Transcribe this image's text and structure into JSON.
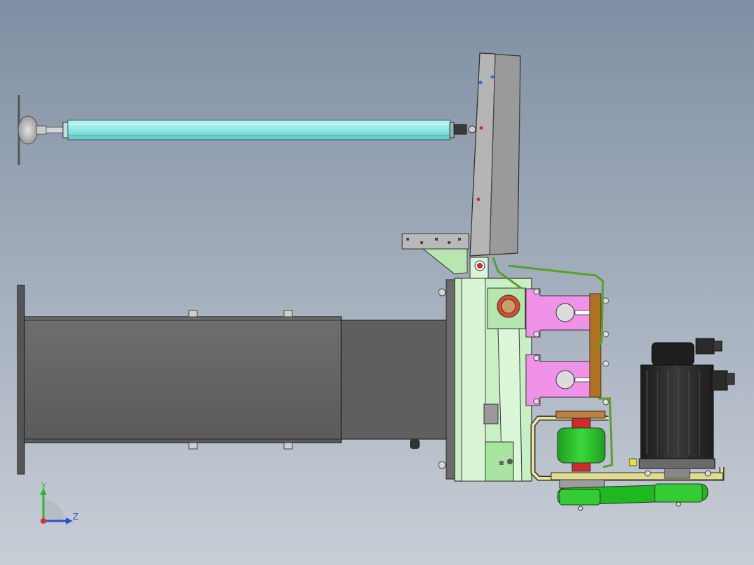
{
  "view": {
    "background_top": "#7f8fa3",
    "background_bottom": "#c8ced6"
  },
  "triad": {
    "y_label": "Y",
    "z_label": "Z",
    "y_color": "#2fb52f",
    "z_color": "#2f4fd6",
    "x_color": "#d62f2f"
  },
  "colors": {
    "rod_cyan": "#8fe8e6",
    "frame_gray": "#616161",
    "frame_dark": "#4e4e4e",
    "plate_gray": "#a9a9a9",
    "bracket_green": "#c9f0c4",
    "clamp_pink": "#f093e8",
    "bar_brown": "#b0721e",
    "pulley_green": "#33cc33",
    "belt_green": "#1fb81f",
    "motor_black": "#2a2a2a",
    "wire_green": "#5aa02c",
    "guard_tan": "#e8e39a",
    "pin_red": "#e03030",
    "bushing_orange": "#d0662c"
  }
}
